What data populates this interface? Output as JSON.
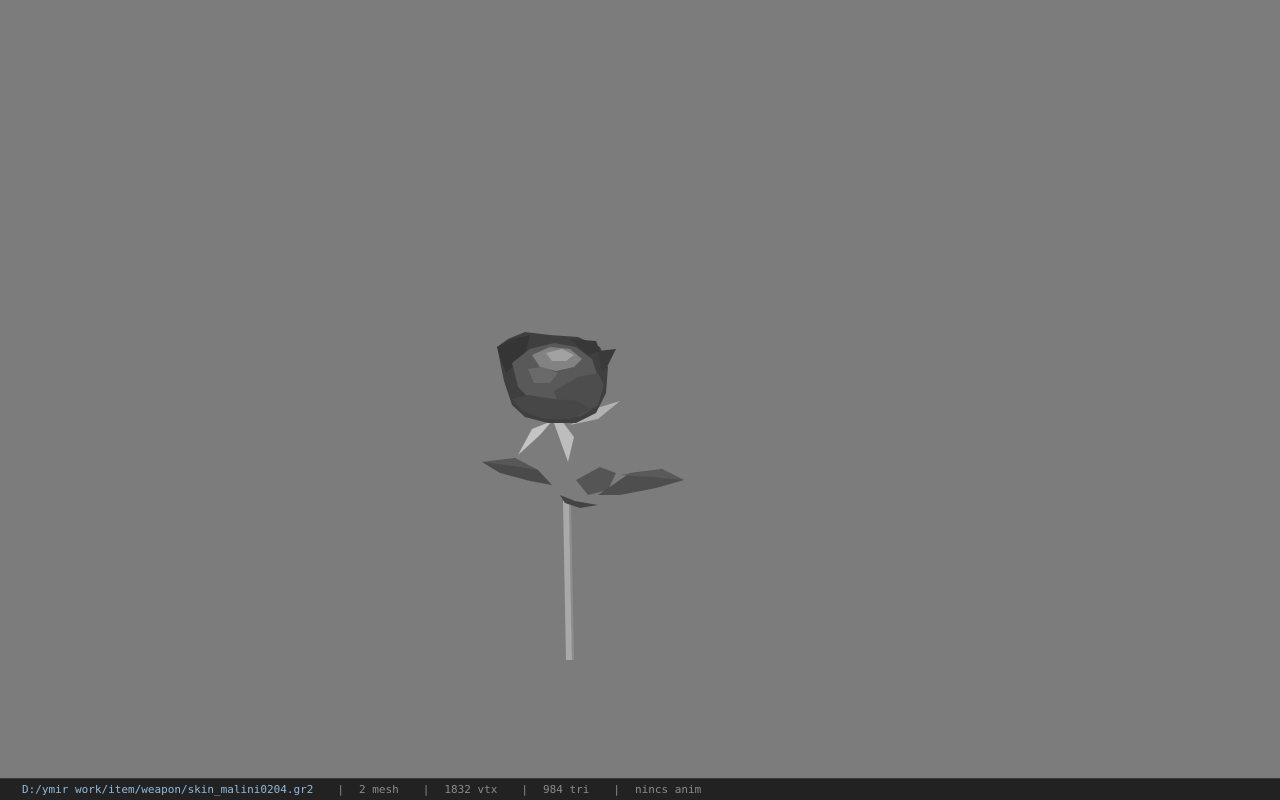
{
  "statusbar": {
    "file_path": "D:/ymir work/item/weapon/skin_malini0204.gr2",
    "separator": "|",
    "mesh_count": "2 mesh",
    "vertex_count": "1832 vtx",
    "triangle_count": "984 tri",
    "anim_status": "nincs anim"
  },
  "colors": {
    "viewport_background": "#7c7c7c",
    "statusbar_background": "#222222",
    "path_text": "#8fb8d8",
    "stat_text": "#8a8a8a"
  },
  "viewport": {
    "model_icon": "rose-model-icon"
  }
}
